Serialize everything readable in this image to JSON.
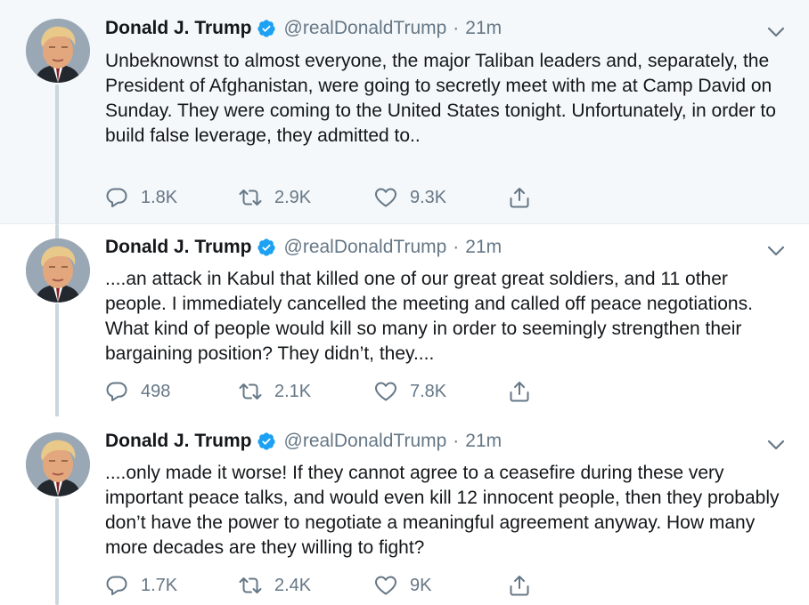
{
  "colors": {
    "verified": "#1da1f2",
    "text": "#14171a",
    "secondary": "#657786",
    "highlight_bg": "#f5f8fa",
    "thread_line": "#ccd6dd"
  },
  "tweets": [
    {
      "author": "Donald J. Trump",
      "handle": "@realDonaldTrump",
      "separator": "·",
      "time": "21m",
      "text": "Unbeknownst to almost everyone, the major Taliban leaders and, separately, the President of Afghanistan, were going to secretly meet with me at Camp David on Sunday. They were coming to the United States tonight. Unfortunately, in order to build false leverage, they admitted to..",
      "replies": "1.8K",
      "retweets": "2.9K",
      "likes": "9.3K"
    },
    {
      "author": "Donald J. Trump",
      "handle": "@realDonaldTrump",
      "separator": "·",
      "time": "21m",
      "text": "....an attack in Kabul that killed one of our great great soldiers, and 11 other people. I immediately cancelled the meeting and called off peace negotiations. What kind of people would kill so many in order to seemingly strengthen their bargaining position? They didn’t, they....",
      "replies": "498",
      "retweets": "2.1K",
      "likes": "7.8K"
    },
    {
      "author": "Donald J. Trump",
      "handle": "@realDonaldTrump",
      "separator": "·",
      "time": "21m",
      "text": "....only made it worse! If they cannot agree to a ceasefire during these very important peace talks, and would even kill 12 innocent people, then they probably don’t have the power to negotiate a meaningful agreement anyway. How many more decades are they willing to fight?",
      "replies": "1.7K",
      "retweets": "2.4K",
      "likes": "9K"
    }
  ]
}
